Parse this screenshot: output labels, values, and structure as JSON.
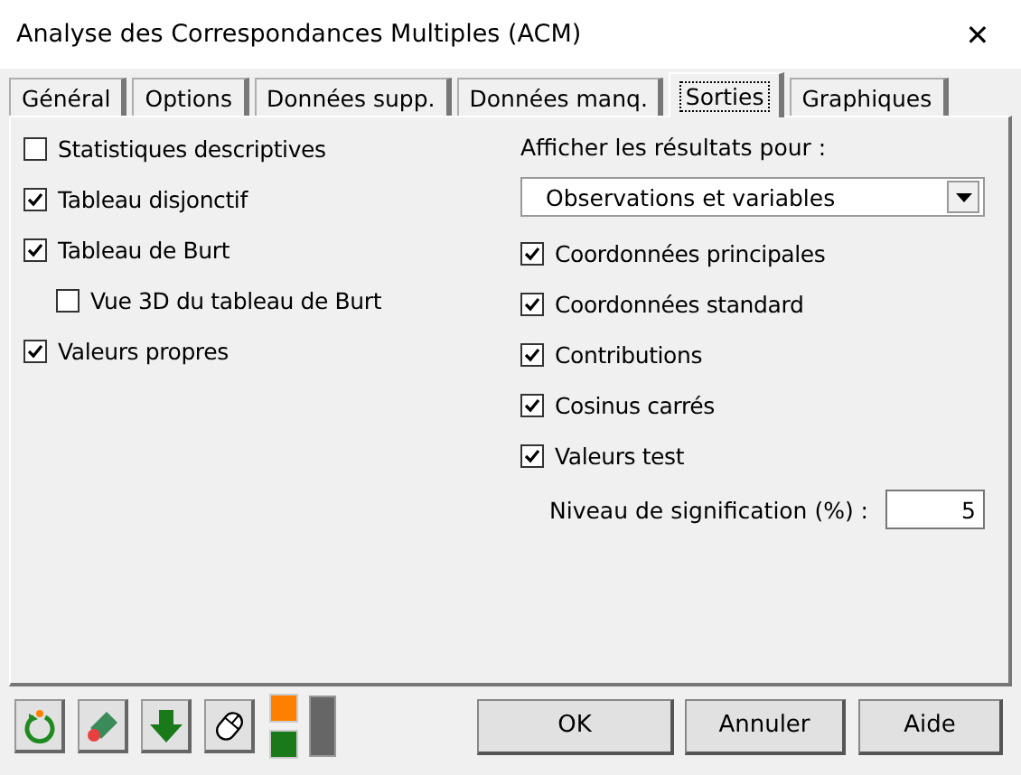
{
  "window": {
    "title": "Analyse des Correspondances Multiples (ACM)",
    "close": "✕"
  },
  "tabs": [
    {
      "label": "Général",
      "selected": false
    },
    {
      "label": "Options",
      "selected": false
    },
    {
      "label": "Données supp.",
      "selected": false
    },
    {
      "label": "Données manq.",
      "selected": false
    },
    {
      "label": "Sorties",
      "selected": true
    },
    {
      "label": "Graphiques",
      "selected": false
    }
  ],
  "left_options": [
    {
      "label": "Statistiques descriptives",
      "checked": false
    },
    {
      "label": "Tableau disjonctif",
      "checked": true
    },
    {
      "label": "Tableau de Burt",
      "checked": true,
      "children": [
        {
          "label": "Vue 3D du tableau de Burt",
          "checked": false
        }
      ]
    },
    {
      "label": "Valeurs propres",
      "checked": true
    }
  ],
  "results": {
    "label": "Afficher les résultats pour :",
    "dropdown": "Observations et variables",
    "options": [
      {
        "label": "Coordonnées principales",
        "checked": true
      },
      {
        "label": "Coordonnées standard",
        "checked": true
      },
      {
        "label": "Contributions",
        "checked": true
      },
      {
        "label": "Cosinus carrés",
        "checked": true
      },
      {
        "label": "Valeurs test",
        "checked": true
      }
    ],
    "significance": {
      "label": "Niveau de signification (%) :",
      "value": "5"
    }
  },
  "buttons": [
    "OK",
    "Annuler",
    "Aide"
  ]
}
